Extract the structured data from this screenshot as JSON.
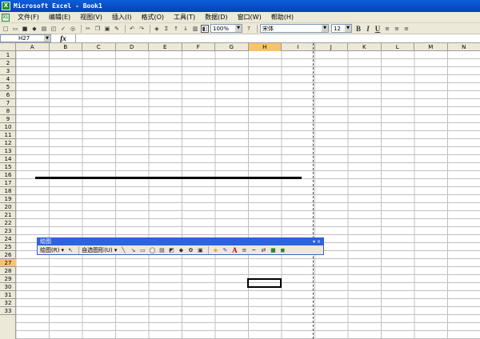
{
  "window": {
    "app_icon": "X",
    "title": "Microsoft Excel - Book1"
  },
  "menu": {
    "doc_icon": "XL",
    "items": [
      "文件(F)",
      "编辑(E)",
      "视图(V)",
      "插入(I)",
      "格式(O)",
      "工具(T)",
      "数据(D)",
      "窗口(W)",
      "帮助(H)"
    ]
  },
  "toolbar": {
    "zoom": "100%",
    "font_name": "宋体",
    "font_size": "12",
    "bold": "B",
    "italic": "I",
    "underline": "U",
    "sum": "Σ"
  },
  "formula_bar": {
    "name_box": "H27",
    "fx": "fx",
    "value": ""
  },
  "columns": [
    "A",
    "B",
    "C",
    "D",
    "E",
    "F",
    "G",
    "H",
    "I",
    "J",
    "K",
    "L",
    "M",
    "N"
  ],
  "selected_column": "H",
  "rows": [
    "1",
    "2",
    "3",
    "4",
    "5",
    "6",
    "7",
    "8",
    "9",
    "10",
    "11",
    "12",
    "13",
    "14",
    "15",
    "16",
    "17",
    "18",
    "19",
    "20",
    "21",
    "22",
    "23",
    "24",
    "25",
    "26",
    "27",
    "28",
    "29",
    "30",
    "31",
    "32",
    "33"
  ],
  "selected_row": "27",
  "active_cell": "H27",
  "drawing_toolbar": {
    "title": "绘图",
    "draw_menu": "绘图(R) ▾",
    "autoshapes_menu": "自选图形(U) ▾"
  },
  "colors": {
    "title_bar": "#0a4fd0",
    "selection_header": "#f7c46c",
    "drawing_title": "#2d62e0"
  }
}
